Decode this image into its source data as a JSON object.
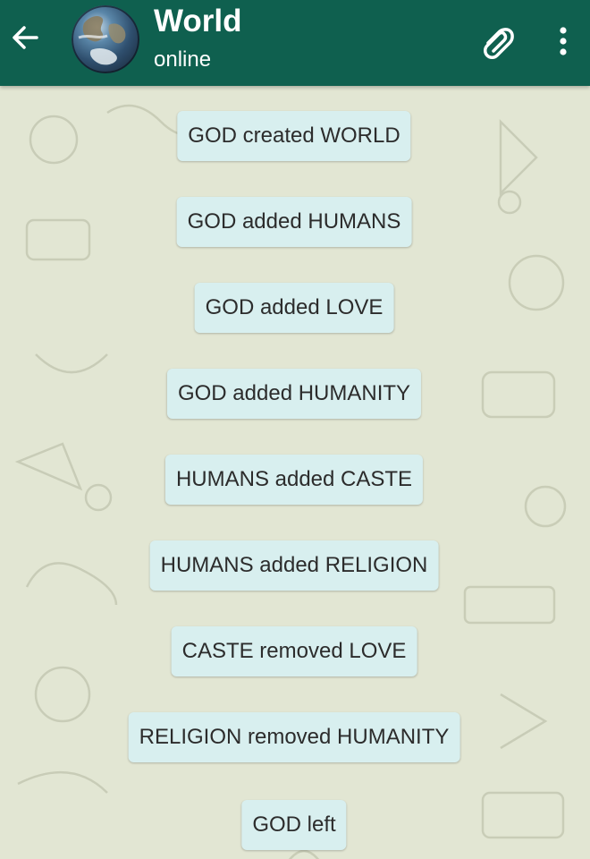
{
  "header": {
    "title": "World",
    "status": "online",
    "background": "#0f604f"
  },
  "icons": {
    "back": "arrow-left-icon",
    "avatar": "earth-globe-avatar",
    "attach": "paperclip-icon",
    "menu": "more-vertical-icon"
  },
  "chat": {
    "bubble_color": "#d8efef",
    "messages": [
      "GOD created WORLD",
      "GOD added HUMANS",
      "GOD added LOVE",
      "GOD added HUMANITY",
      "HUMANS added CASTE",
      "HUMANS added RELIGION",
      "CASTE removed LOVE",
      "RELIGION removed HUMANITY",
      "GOD left"
    ]
  }
}
